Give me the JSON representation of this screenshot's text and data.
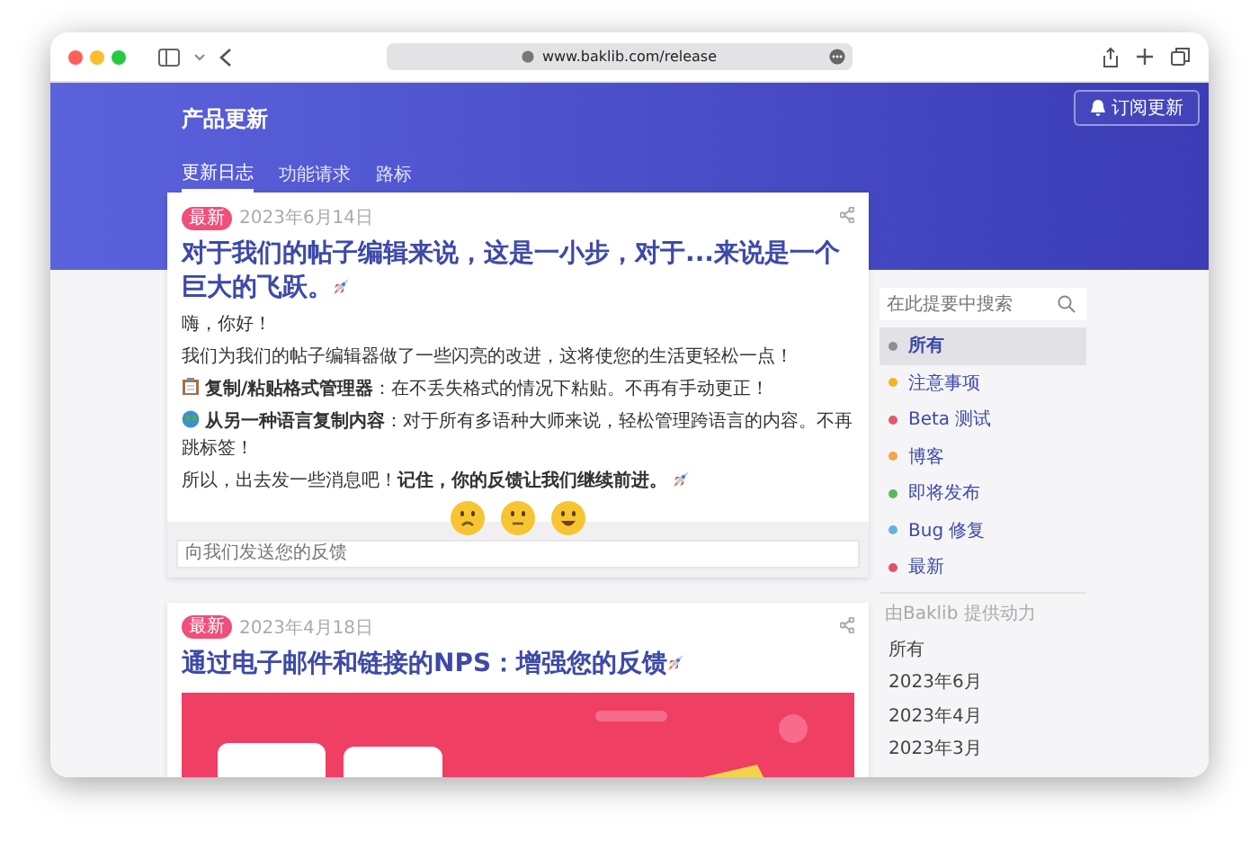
{
  "browser": {
    "url": "www.baklib.com/release"
  },
  "header": {
    "title": "产品更新",
    "subscribe_button": "订阅更新"
  },
  "tabs": [
    {
      "label": "更新日志",
      "selected": true
    },
    {
      "label": "功能请求",
      "selected": false
    },
    {
      "label": "路标",
      "selected": false
    }
  ],
  "posts": [
    {
      "tag": "最新",
      "date": "2023年6月14日",
      "title": "对于我们的帖子编辑来说，这是一小步，对于...来说是一个巨大的飞跃。",
      "paragraphs": [
        {
          "kind": "plain",
          "text": "嗨，你好！"
        },
        {
          "kind": "plain",
          "text": "我们为我们的帖子编辑器做了一些闪亮的改进，这将使您的生活更轻松一点！"
        },
        {
          "kind": "clipboard",
          "text": "**复制/粘贴格式管理器**：在不丢失格式的情况下粘贴。不再有手动更正！"
        },
        {
          "kind": "globe",
          "text": "**从另一种语言复制内容**：对于所有多语种大师来说，轻松管理跨语言的内容。不再跳标签！"
        },
        {
          "kind": "closing",
          "text": "所以，出去发一些消息吧！**记住，你的反馈让我们继续前进。**"
        }
      ],
      "feedback": {
        "placeholder": "向我们发送您的反馈"
      }
    },
    {
      "tag": "最新",
      "date": "2023年4月18日",
      "title": "通过电子邮件和链接的NPS：增强您的反馈"
    }
  ],
  "sidebar": {
    "search": {
      "placeholder": "在此提要中搜索"
    },
    "categories": [
      {
        "label": "所有",
        "color": "#8a8f99",
        "selected": true
      },
      {
        "label": "注意事项",
        "color": "#f0b429",
        "selected": false
      },
      {
        "label": "Beta 测试",
        "color": "#e05a6d",
        "selected": false
      },
      {
        "label": "博客",
        "color": "#f5a54a",
        "selected": false
      },
      {
        "label": "即将发布",
        "color": "#5cb85c",
        "selected": false
      },
      {
        "label": "Bug 修复",
        "color": "#6ab0de",
        "selected": false
      },
      {
        "label": "最新",
        "color": "#e0506a",
        "selected": false
      }
    ],
    "powered_by": "由Baklib 提供动力",
    "archive": [
      "所有",
      "2023年6月",
      "2023年4月",
      "2023年3月"
    ]
  }
}
